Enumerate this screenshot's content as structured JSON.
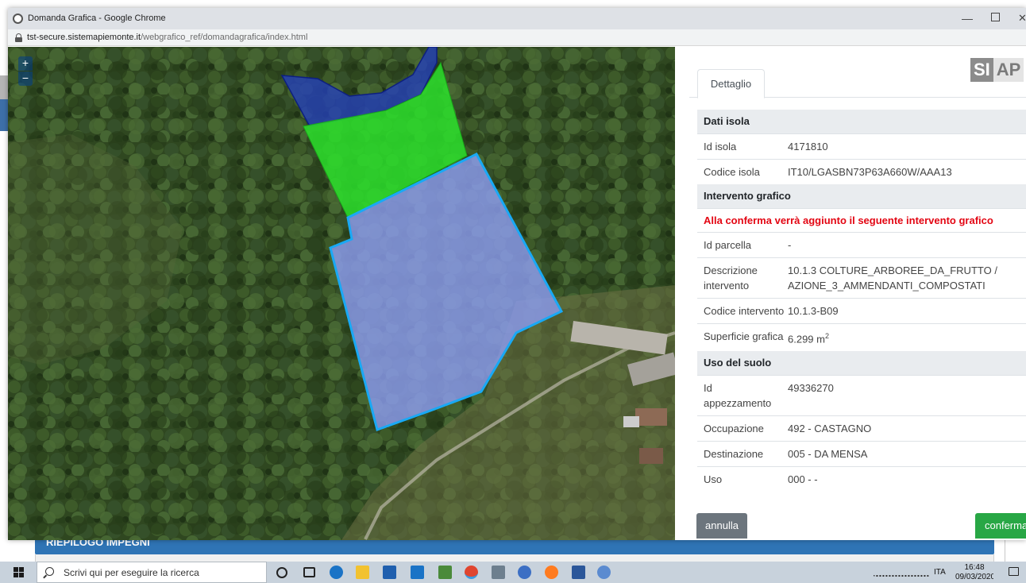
{
  "window": {
    "title": "Domanda Grafica - Google Chrome",
    "url_domain": "tst-secure.sistemapiemonte.it",
    "url_path": "/webgrafico_ref/domandagrafica/index.html",
    "minimize_glyph": "—",
    "close_glyph": "✕"
  },
  "map": {
    "zoom_in": "+",
    "zoom_out": "−"
  },
  "panel": {
    "logo": "SIAP",
    "tab": "Dettaglio",
    "sections": {
      "dati_isola": "Dati isola",
      "intervento_grafico": "Intervento grafico",
      "uso_suolo": "Uso del suolo"
    },
    "warning": "Alla conferma verrà aggiunto il seguente intervento grafico",
    "rows": {
      "id_isola": {
        "label": "Id isola",
        "value": "4171810"
      },
      "codice_isola": {
        "label": "Codice isola",
        "value": "IT10/LGASBN73P63A660W/AAA13"
      },
      "id_parcella": {
        "label": "Id parcella",
        "value": "-"
      },
      "descrizione": {
        "label": "Descrizione intervento",
        "value": "10.1.3 COLTURE_ARBOREE_DA_FRUTTO / AZIONE_3_AMMENDANTI_COMPOSTATI"
      },
      "codice_intervento": {
        "label": "Codice intervento",
        "value": "10.1.3-B09"
      },
      "superficie": {
        "label": "Superficie grafica",
        "value": "6.299 m",
        "unit_exp": "2"
      },
      "id_appezzamento": {
        "label": "Id appezzamento",
        "value": "49336270"
      },
      "occupazione": {
        "label": "Occupazione",
        "value": "492 - CASTAGNO"
      },
      "destinazione": {
        "label": "Destinazione",
        "value": "005 - DA MENSA"
      },
      "uso": {
        "label": "Uso",
        "value": "000 - -"
      }
    },
    "buttons": {
      "annulla": "annulla",
      "conferma": "conferma"
    }
  },
  "background_page": {
    "panel_heading": "RIEPILOGO IMPEGNI"
  },
  "taskbar": {
    "search_placeholder": "Scrivi qui per eseguire la ricerca",
    "language": "ITA",
    "time": "16:48",
    "date": "09/03/2020"
  },
  "colors": {
    "warning": "#e30613",
    "section_bg": "#e9ecef",
    "conferma": "#28a745",
    "annulla": "#6c757d",
    "parcel_green": "#2be02b",
    "parcel_blue": "#2440b8",
    "parcel_selected_fill": "#8c9cf0",
    "parcel_selected_border": "#19a9f5"
  }
}
